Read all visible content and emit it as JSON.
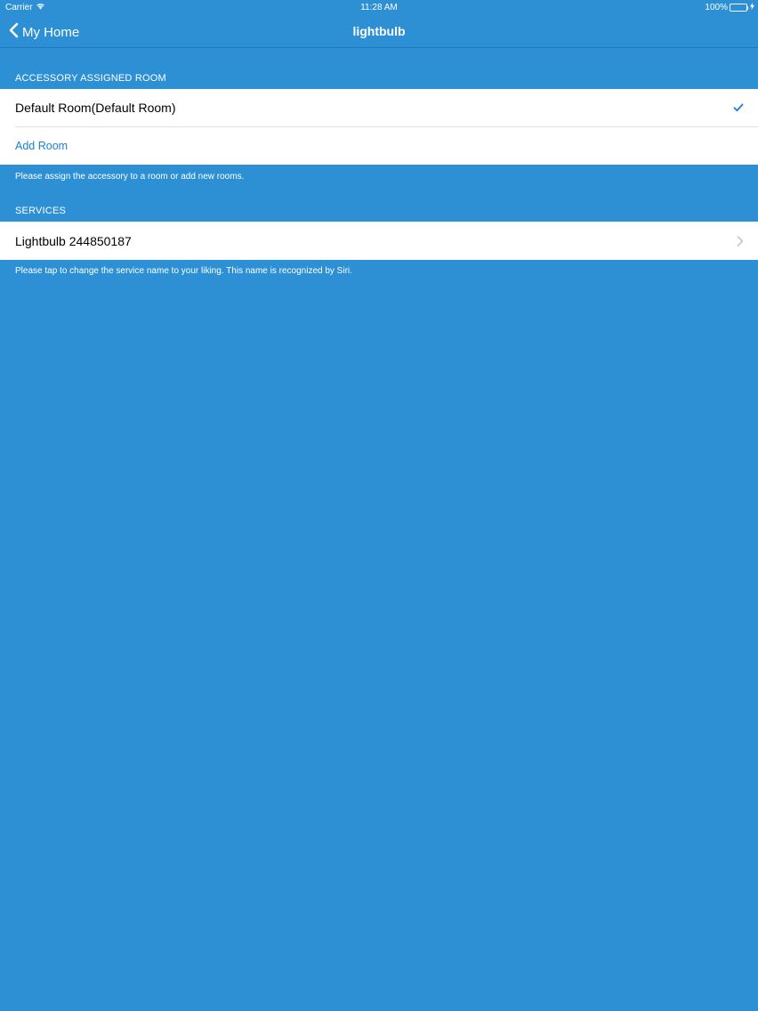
{
  "status_bar": {
    "carrier": "Carrier",
    "time": "11:28 AM",
    "battery": "100%",
    "battery_level": 1.0
  },
  "nav": {
    "back_label": "My Home",
    "title": "lightbulb"
  },
  "room_section": {
    "header": "ACCESSORY ASSIGNED ROOM",
    "selected_room": "Default Room(Default Room)",
    "add_room_label": "Add Room",
    "footer": "Please assign the accessory to a room or add new rooms."
  },
  "services_section": {
    "header": "SERVICES",
    "service_name": "Lightbulb 244850187",
    "footer": "Please tap to change the service name to your liking. This name is recognized by Siri."
  },
  "colors": {
    "background": "#2d90d4",
    "accent": "#1a7ed8",
    "battery": "#4cd964"
  },
  "icons": {
    "back": "chevron-left-icon",
    "check": "checkmark-icon",
    "disclosure": "chevron-right-icon",
    "wifi": "wifi-icon",
    "battery": "battery-icon",
    "charging": "charging-bolt-icon"
  }
}
